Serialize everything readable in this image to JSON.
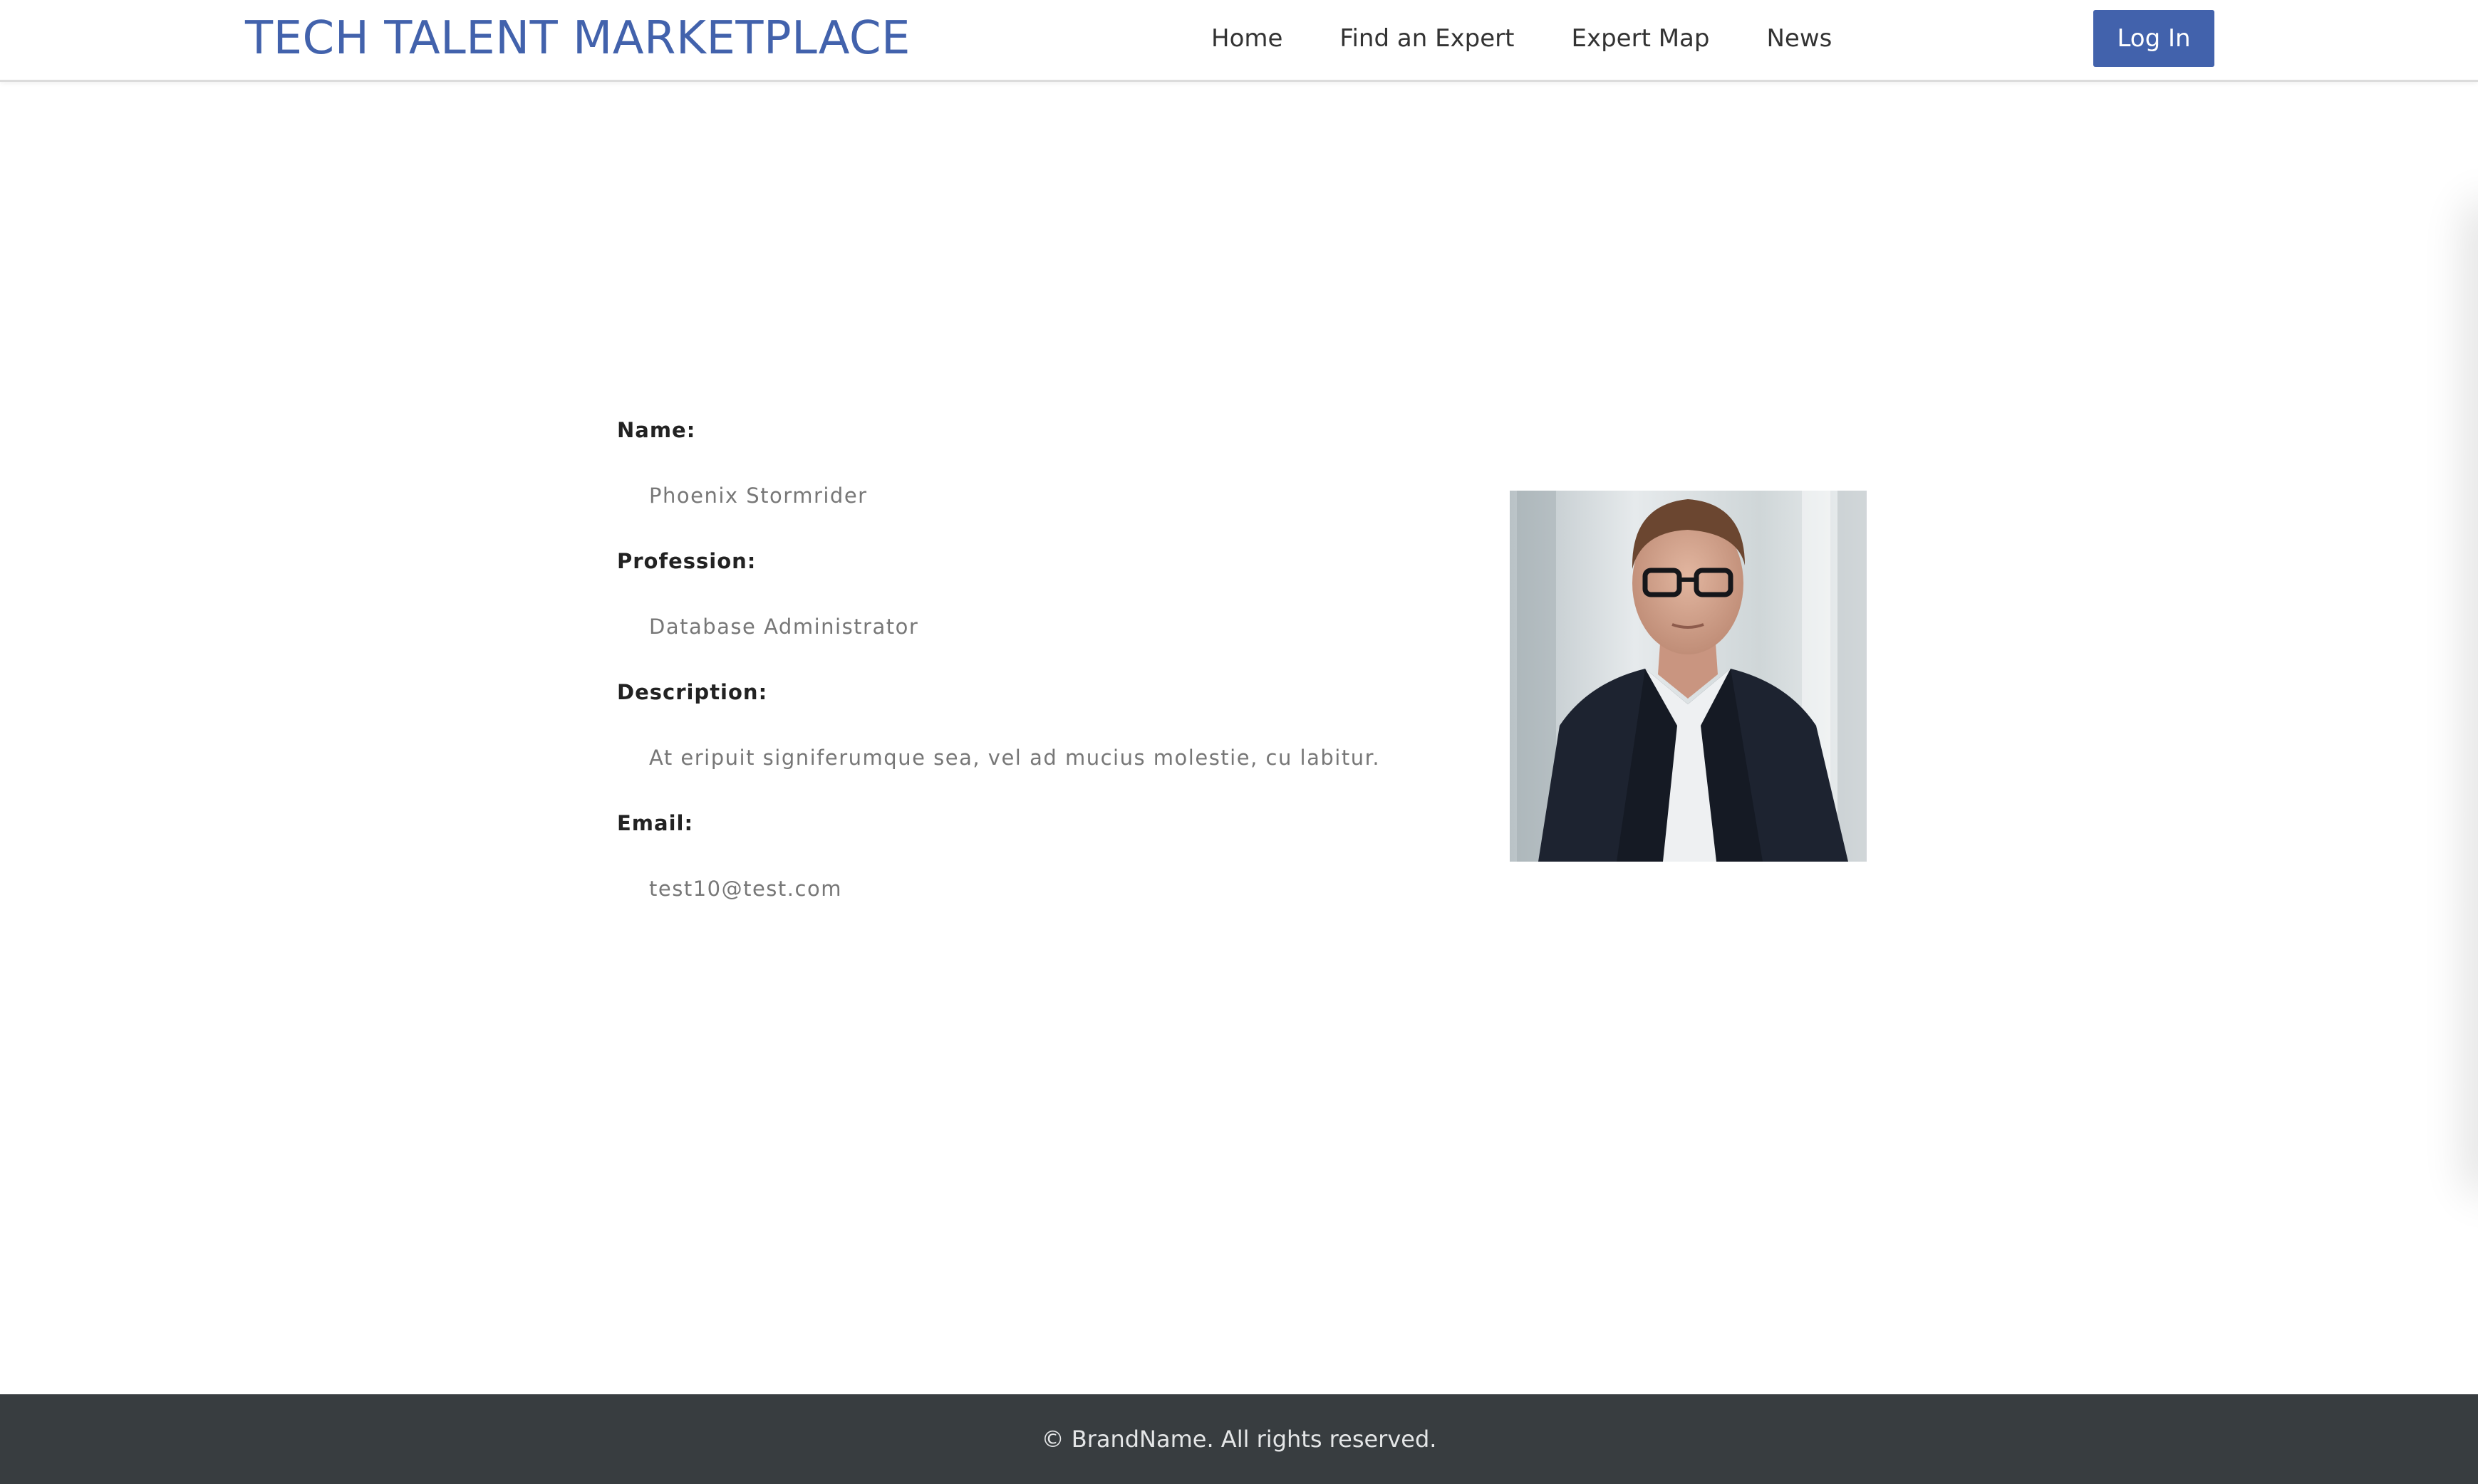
{
  "header": {
    "brand": "TECH TALENT MARKETPLACE",
    "nav": [
      "Home",
      "Find an Expert",
      "Expert Map",
      "News"
    ],
    "login_label": "Log In"
  },
  "profile": {
    "name_label": "Name:",
    "name": "Phoenix Stormrider",
    "profession_label": "Profession:",
    "profession": "Database Administrator",
    "description_label": "Description:",
    "description": "At eripuit signiferumque sea, vel ad mucius molestie, cu labitur.",
    "email_label": "Email:",
    "email": "test10@test.com"
  },
  "footer": {
    "text": "© BrandName. All rights reserved."
  },
  "colors": {
    "brand": "#4262ac",
    "footer_bg": "#383d40",
    "label_text": "#222222",
    "value_text": "#777777"
  }
}
